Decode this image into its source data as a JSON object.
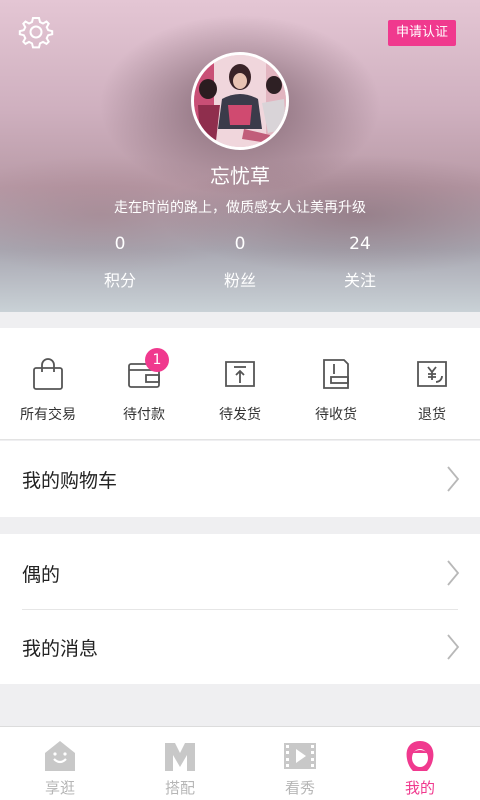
{
  "header": {
    "apply_label": "申请认证",
    "username": "忘忧草",
    "motto": "走在时尚的路上，做质感女人让美再升级",
    "stats": [
      {
        "value": "0",
        "label": "积分"
      },
      {
        "value": "0",
        "label": "粉丝"
      },
      {
        "value": "24",
        "label": "关注"
      }
    ]
  },
  "orders": {
    "items": [
      {
        "label": "所有交易",
        "icon": "bag-icon"
      },
      {
        "label": "待付款",
        "icon": "wallet-icon",
        "badge": "1"
      },
      {
        "label": "待发货",
        "icon": "ship-icon"
      },
      {
        "label": "待收货",
        "icon": "receive-icon"
      },
      {
        "label": "退货",
        "icon": "refund-icon"
      }
    ]
  },
  "menu": {
    "cart": "我的购物车",
    "idol": "偶的",
    "messages": "我的消息"
  },
  "tabbar": {
    "tabs": [
      {
        "label": "享逛",
        "icon": "house-icon"
      },
      {
        "label": "搭配",
        "icon": "m-icon"
      },
      {
        "label": "看秀",
        "icon": "film-icon"
      },
      {
        "label": "我的",
        "icon": "profile-icon",
        "active": true
      }
    ]
  },
  "colors": {
    "accent": "#f0398e",
    "inactive": "#b6b6b6"
  }
}
